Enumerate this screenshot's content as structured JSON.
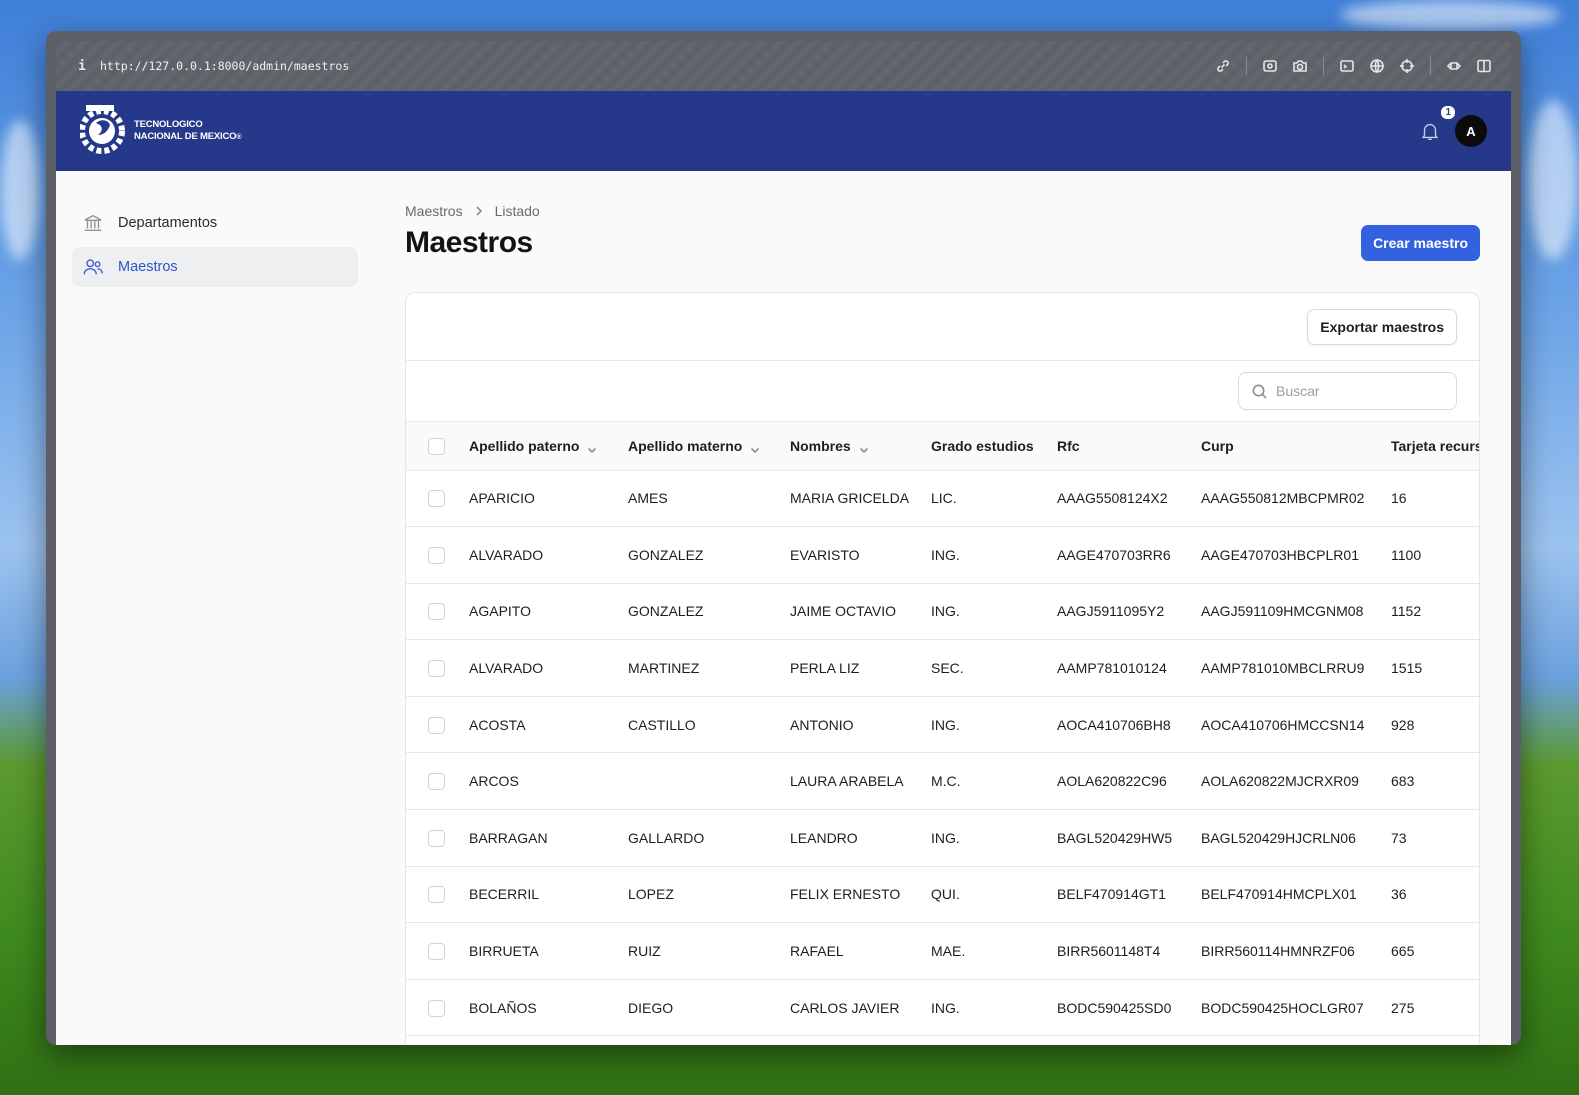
{
  "browser": {
    "url": "http://127.0.0.1:8000/admin/maestros",
    "icons": [
      "link-icon",
      "screenshot-icon",
      "camera-icon",
      "terminal-icon",
      "globe-icon",
      "crosshair-icon",
      "extensions-icon",
      "sidebar-icon"
    ]
  },
  "header": {
    "logo_line1": "TECNOLOGICO",
    "logo_line2": "NACIONAL DE MEXICO",
    "logo_mark": "®",
    "notification_count": "1",
    "avatar_initial": "A",
    "brand_color": "#26388a"
  },
  "sidebar": {
    "items": [
      {
        "label": "Departamentos",
        "icon": "building-columns-icon",
        "active": false
      },
      {
        "label": "Maestros",
        "icon": "users-icon",
        "active": true
      }
    ]
  },
  "main": {
    "breadcrumb": [
      "Maestros",
      "Listado"
    ],
    "title": "Maestros",
    "create_button": "Crear maestro",
    "export_button": "Exportar maestros",
    "search_placeholder": "Buscar"
  },
  "table": {
    "columns": [
      "Apellido paterno",
      "Apellido materno",
      "Nombres",
      "Grado estudios",
      "Rfc",
      "Curp",
      "Tarjeta recurs"
    ],
    "rows": [
      [
        "APARICIO",
        "AMES",
        "MARIA GRICELDA",
        "LIC.",
        "AAAG5508124X2",
        "AAAG550812MBCPMR02",
        "16"
      ],
      [
        "ALVARADO",
        "GONZALEZ",
        "EVARISTO",
        "ING.",
        "AAGE470703RR6",
        "AAGE470703HBCPLR01",
        "1100"
      ],
      [
        "AGAPITO",
        "GONZALEZ",
        "JAIME OCTAVIO",
        "ING.",
        "AAGJ5911095Y2",
        "AAGJ591109HMCGNM08",
        "1152"
      ],
      [
        "ALVARADO",
        "MARTINEZ",
        "PERLA LIZ",
        "SEC.",
        "AAMP781010124",
        "AAMP781010MBCLRRU9",
        "1515"
      ],
      [
        "ACOSTA",
        "CASTILLO",
        "ANTONIO",
        "ING.",
        "AOCA410706BH8",
        "AOCA410706HMCCSN14",
        "928"
      ],
      [
        "ARCOS",
        "",
        "LAURA ARABELA",
        "M.C.",
        "AOLA620822C96",
        "AOLA620822MJCRXR09",
        "683"
      ],
      [
        "BARRAGAN",
        "GALLARDO",
        "LEANDRO",
        "ING.",
        "BAGL520429HW5",
        "BAGL520429HJCRLN06",
        "73"
      ],
      [
        "BECERRIL",
        "LOPEZ",
        "FELIX ERNESTO",
        "QUI.",
        "BELF470914GT1",
        "BELF470914HMCPLX01",
        "36"
      ],
      [
        "BIRRUETA",
        "RUIZ",
        "RAFAEL",
        "MAE.",
        "BIRR5601148T4",
        "BIRR560114HMNRZF06",
        "665"
      ],
      [
        "BOLAÑOS",
        "DIEGO",
        "CARLOS JAVIER",
        "ING.",
        "BODC590425SD0",
        "BODC590425HOCLGR07",
        "275"
      ]
    ]
  }
}
